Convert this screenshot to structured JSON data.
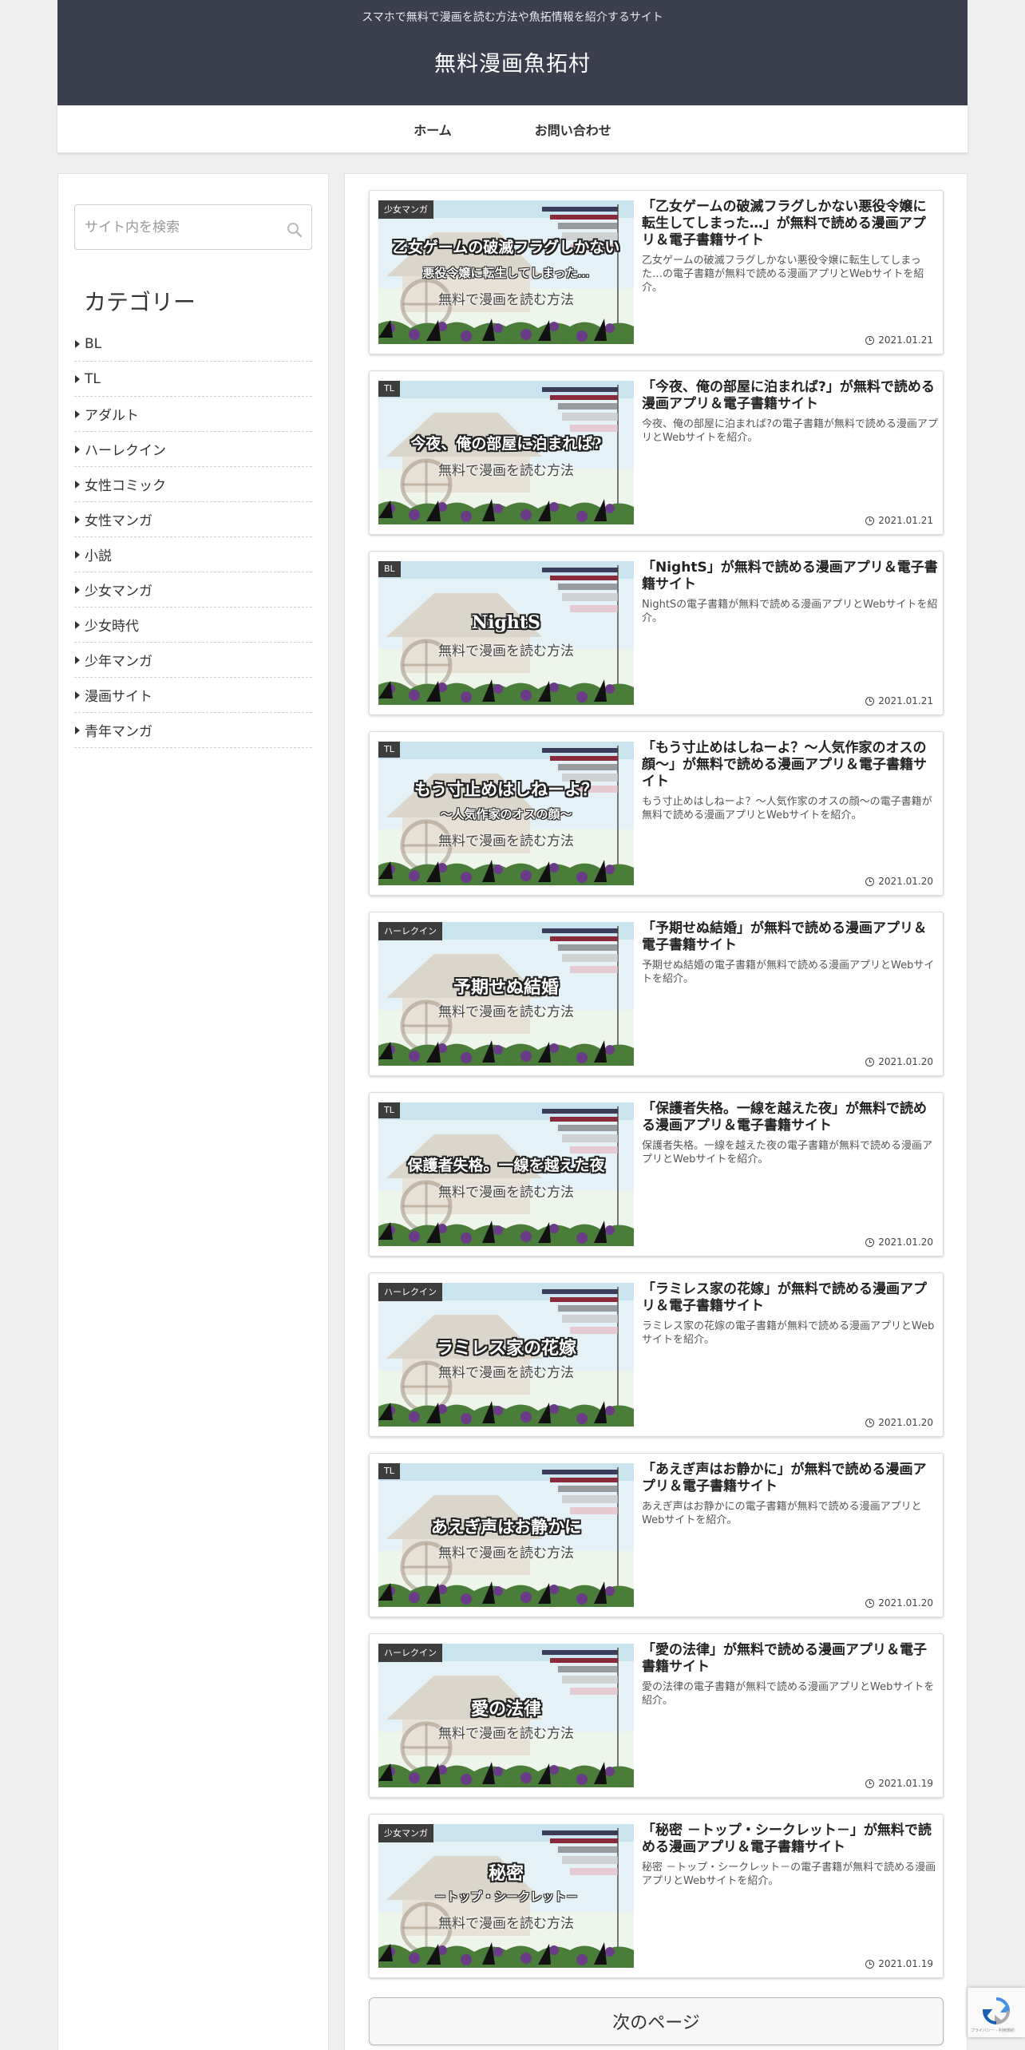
{
  "header": {
    "tagline": "スマホで無料で漫画を読む方法や魚拓情報を紹介するサイト",
    "site_title": "無料漫画魚拓村"
  },
  "nav": {
    "items": [
      {
        "label": "ホーム"
      },
      {
        "label": "お問い合わせ"
      }
    ]
  },
  "sidebar": {
    "search_placeholder": "サイト内を検索",
    "categories_heading": "カテゴリー",
    "categories": [
      {
        "label": "BL"
      },
      {
        "label": "TL"
      },
      {
        "label": "アダルト"
      },
      {
        "label": "ハーレクイン"
      },
      {
        "label": "女性コミック"
      },
      {
        "label": "女性マンガ"
      },
      {
        "label": "小説"
      },
      {
        "label": "少女マンガ"
      },
      {
        "label": "少女時代"
      },
      {
        "label": "少年マンガ"
      },
      {
        "label": "漫画サイト"
      },
      {
        "label": "青年マンガ"
      }
    ]
  },
  "posts": [
    {
      "category": "少女マンガ",
      "title": "「乙女ゲームの破滅フラグしかない悪役令嬢に転生してしまった…」が無料で読める漫画アプリ＆電子書籍サイト",
      "excerpt": "乙女ゲームの破滅フラグしかない悪役令嬢に転生してしまった…の電子書籍が無料で読める漫画アプリとWebサイトを紹介。",
      "date": "2021.01.21",
      "thumb_title": "乙女ゲームの破滅フラグしかない",
      "thumb_sub": "悪役令嬢に転生してしまった…",
      "thumb_lead": "無料で漫画を読む方法"
    },
    {
      "category": "TL",
      "title": "「今夜、俺の部屋に泊まれば?」が無料で読める漫画アプリ＆電子書籍サイト",
      "excerpt": "今夜、俺の部屋に泊まれば?の電子書籍が無料で読める漫画アプリとWebサイトを紹介。",
      "date": "2021.01.21",
      "thumb_title": "今夜、俺の部屋に泊まれば?",
      "thumb_sub": "",
      "thumb_lead": "無料で漫画を読む方法"
    },
    {
      "category": "BL",
      "title": "「NightS」が無料で読める漫画アプリ＆電子書籍サイト",
      "excerpt": "NightSの電子書籍が無料で読める漫画アプリとWebサイトを紹介。",
      "date": "2021.01.21",
      "thumb_title": "NightS",
      "thumb_sub": "",
      "thumb_lead": "無料で漫画を読む方法"
    },
    {
      "category": "TL",
      "title": "「もう寸止めはしねーよ？～人気作家のオスの顔～」が無料で読める漫画アプリ＆電子書籍サイト",
      "excerpt": "もう寸止めはしねーよ？～人気作家のオスの顔～の電子書籍が無料で読める漫画アプリとWebサイトを紹介。",
      "date": "2021.01.20",
      "thumb_title": "もう寸止めはしねーよ？",
      "thumb_sub": "～人気作家のオスの顔～",
      "thumb_lead": "無料で漫画を読む方法"
    },
    {
      "category": "ハーレクイン",
      "title": "「予期せぬ結婚」が無料で読める漫画アプリ＆電子書籍サイト",
      "excerpt": "予期せぬ結婚の電子書籍が無料で読める漫画アプリとWebサイトを紹介。",
      "date": "2021.01.20",
      "thumb_title": "予期せぬ結婚",
      "thumb_sub": "",
      "thumb_lead": "無料で漫画を読む方法"
    },
    {
      "category": "TL",
      "title": "「保護者失格。一線を越えた夜」が無料で読める漫画アプリ＆電子書籍サイト",
      "excerpt": "保護者失格。一線を越えた夜の電子書籍が無料で読める漫画アプリとWebサイトを紹介。",
      "date": "2021.01.20",
      "thumb_title": "保護者失格。一線を越えた夜",
      "thumb_sub": "",
      "thumb_lead": "無料で漫画を読む方法"
    },
    {
      "category": "ハーレクイン",
      "title": "「ラミレス家の花嫁」が無料で読める漫画アプリ＆電子書籍サイト",
      "excerpt": "ラミレス家の花嫁の電子書籍が無料で読める漫画アプリとWebサイトを紹介。",
      "date": "2021.01.20",
      "thumb_title": "ラミレス家の花嫁",
      "thumb_sub": "",
      "thumb_lead": "無料で漫画を読む方法"
    },
    {
      "category": "TL",
      "title": "「あえぎ声はお静かに」が無料で読める漫画アプリ＆電子書籍サイト",
      "excerpt": "あえぎ声はお静かにの電子書籍が無料で読める漫画アプリとWebサイトを紹介。",
      "date": "2021.01.20",
      "thumb_title": "あえぎ声はお静かに",
      "thumb_sub": "",
      "thumb_lead": "無料で漫画を読む方法"
    },
    {
      "category": "ハーレクイン",
      "title": "「愛の法律」が無料で読める漫画アプリ＆電子書籍サイト",
      "excerpt": "愛の法律の電子書籍が無料で読める漫画アプリとWebサイトを紹介。",
      "date": "2021.01.19",
      "thumb_title": "愛の法律",
      "thumb_sub": "",
      "thumb_lead": "無料で漫画を読む方法"
    },
    {
      "category": "少女マンガ",
      "title": "「秘密 －トップ・シークレット－」が無料で読める漫画アプリ＆電子書籍サイト",
      "excerpt": "秘密 －トップ・シークレット－の電子書籍が無料で読める漫画アプリとWebサイトを紹介。",
      "date": "2021.01.19",
      "thumb_title": "秘密",
      "thumb_sub": "－トップ・シークレット－",
      "thumb_lead": "無料で漫画を読む方法"
    }
  ],
  "pagination": {
    "next_label": "次のページ"
  },
  "recaptcha": {
    "footer_text": "プライバシー - 利用規約"
  },
  "colors": {
    "header_bg": "#3b3f4d",
    "badge_bg": "#3d3d3d",
    "page_bg": "#efefef"
  }
}
